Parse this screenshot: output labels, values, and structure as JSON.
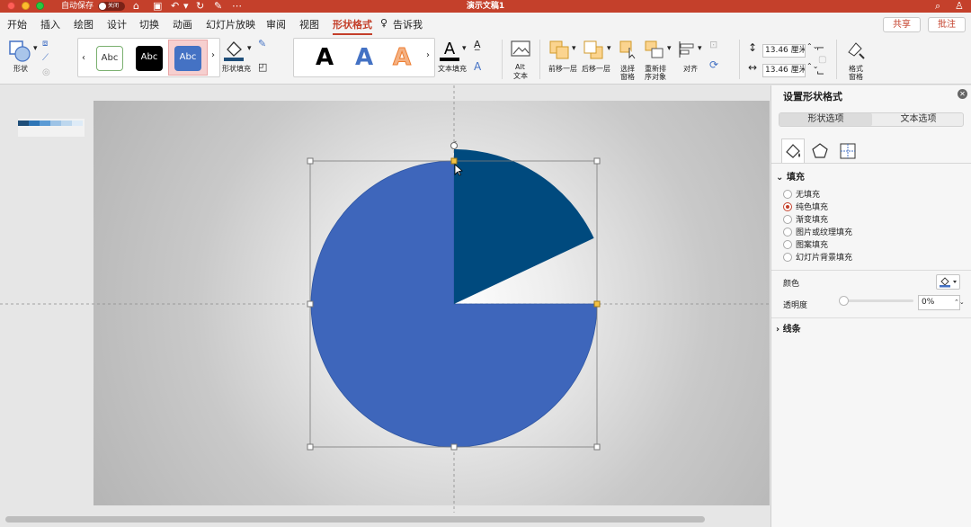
{
  "titlebar": {
    "autosave_label": "自动保存",
    "autosave_state": "关闭",
    "document_title": "演示文稿1"
  },
  "menu": {
    "tabs": [
      "开始",
      "插入",
      "绘图",
      "设计",
      "切换",
      "动画",
      "幻灯片放映",
      "审阅",
      "视图",
      "形状格式"
    ],
    "active_tab": "形状格式",
    "tell_me": "告诉我",
    "share": "共享",
    "comments": "批注"
  },
  "ribbon": {
    "shapes_label": "形状",
    "style_samples": [
      "Abc",
      "Abc",
      "Abc"
    ],
    "shape_fill_label": "形状填充",
    "wordart_samples": [
      "A",
      "A",
      "A"
    ],
    "text_fill_label": "文本填充",
    "alt_text_label_1": "Alt",
    "alt_text_label_2": "文本",
    "bring_forward_label": "前移一层",
    "send_backward_label": "后移一层",
    "selection_pane_label_1": "选择",
    "selection_pane_label_2": "窗格",
    "reorder_label_1": "重新排",
    "reorder_label_2": "序对象",
    "align_label": "对齐",
    "height_value": "13.46 厘米",
    "width_value": "13.46 厘米",
    "format_pane_label_1": "格式",
    "format_pane_label_2": "窗格",
    "accent_color": "#c4402b",
    "fill_color": "#4472c4"
  },
  "panel": {
    "title": "设置形状格式",
    "tab_shape": "形状选项",
    "tab_text": "文本选项",
    "fill_section": "填充",
    "fill_options": [
      "无填充",
      "纯色填充",
      "渐变填充",
      "图片或纹理填充",
      "图案填充",
      "幻灯片背景填充"
    ],
    "selected_fill_index": 1,
    "color_label": "颜色",
    "transparency_label": "透明度",
    "transparency_value": "0%",
    "line_section": "线条"
  },
  "slide": {
    "main_shape_color": "#3e66bb",
    "slice_color": "#004a7e",
    "slice_pct_of_circle": 0.18
  }
}
